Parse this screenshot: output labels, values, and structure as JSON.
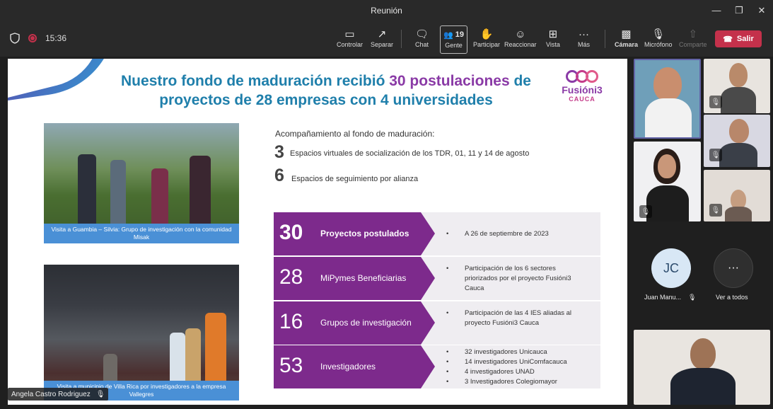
{
  "window": {
    "title": "Reunión"
  },
  "toolbar": {
    "time": "15:36",
    "controlar": "Controlar",
    "separar": "Separar",
    "chat": "Chat",
    "gente": "Gente",
    "gente_count": "19",
    "participar": "Participar",
    "reaccionar": "Reaccionar",
    "vista": "Vista",
    "mas": "Más",
    "camara": "Cámara",
    "microfono": "Micrófono",
    "comparte": "Comparte",
    "salir": "Salir"
  },
  "slide": {
    "title_part1": "Nuestro fondo de maduración recibió ",
    "title_highlight": "30 postulaciones",
    "title_part2": " de proyectos de 28 empresas con 4 universidades",
    "logo_brand": "Fusióni3",
    "logo_sub": "CAUCA",
    "photo1_caption": "Visita a Guambia – Silvia: Grupo de investigación con la comunidad Misak",
    "photo2_caption": "Visita a municipio de Villa Rica por investigadores a la empresa Vallegres",
    "acomp_title": "Acompañamiento al fondo de maduración:",
    "item1_num": "3",
    "item1_text": "Espacios virtuales de socialización de los TDR, 01, 11 y 14 de agosto",
    "item2_num": "6",
    "item2_text": "Espacios de seguimiento por alianza",
    "rows": [
      {
        "num": "30",
        "label": "Proyectos postulados",
        "details": [
          "A 26 de septiembre de 2023"
        ]
      },
      {
        "num": "28",
        "label": "MiPymes Beneficiarias",
        "details": [
          "Participación de los 6 sectores priorizados por el proyecto Fusióni3 Cauca"
        ]
      },
      {
        "num": "16",
        "label": "Grupos de investigación",
        "details": [
          "Participación de las 4 IES aliadas al proyecto Fusióni3 Cauca"
        ]
      },
      {
        "num": "53",
        "label": "Investigadores",
        "details": [
          "32 investigadores Unicauca",
          "14 investigadores UniComfacauca",
          "4 investigadores UNAD",
          "3 Investigadores Colegiomayor"
        ]
      }
    ]
  },
  "presenter": {
    "name": "Angela Castro Rodriguez"
  },
  "participants": {
    "jc_initials": "JC",
    "jc_name": "Juan Manu...",
    "ver_todos": "Ver a todos"
  },
  "colors": {
    "accent_purple": "#7d2a8c",
    "title_blue": "#1f7fab",
    "salir_red": "#c4314b"
  }
}
